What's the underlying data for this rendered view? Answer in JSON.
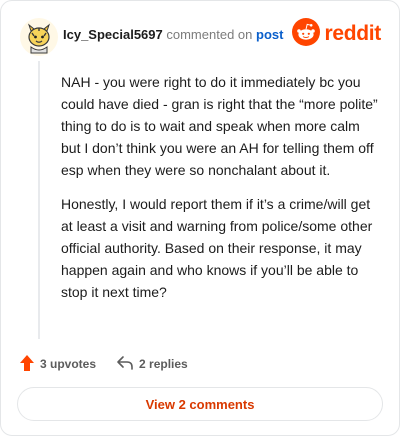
{
  "comment": {
    "username": "Icy_Special5697",
    "byline_mid": "commented on",
    "post_link": "post",
    "paragraphs": [
      "NAH - you were right to do it immediately bc you could have died - gran is right that the “more polite” thing to do is to wait and speak when more calm but I don’t think you were an AH for telling them off esp when they were so nonchalant about it.",
      "Honestly, I would report them if it’s a crime/will get at least a visit and warning from police/some other official authority. Based on their response, it may happen again and who knows if you’ll be able to stop it next time?"
    ]
  },
  "brand": {
    "wordmark": "reddit",
    "color": "#ff4500"
  },
  "actions": {
    "upvotes": "3 upvotes",
    "replies": "2 replies"
  },
  "footer": {
    "view_comments": "View 2 comments"
  },
  "icons": {
    "avatar": "snoo-avatar-icon",
    "brand_logo": "reddit-logo-icon",
    "upvote": "upvote-arrow-icon",
    "reply": "reply-arrow-icon"
  }
}
